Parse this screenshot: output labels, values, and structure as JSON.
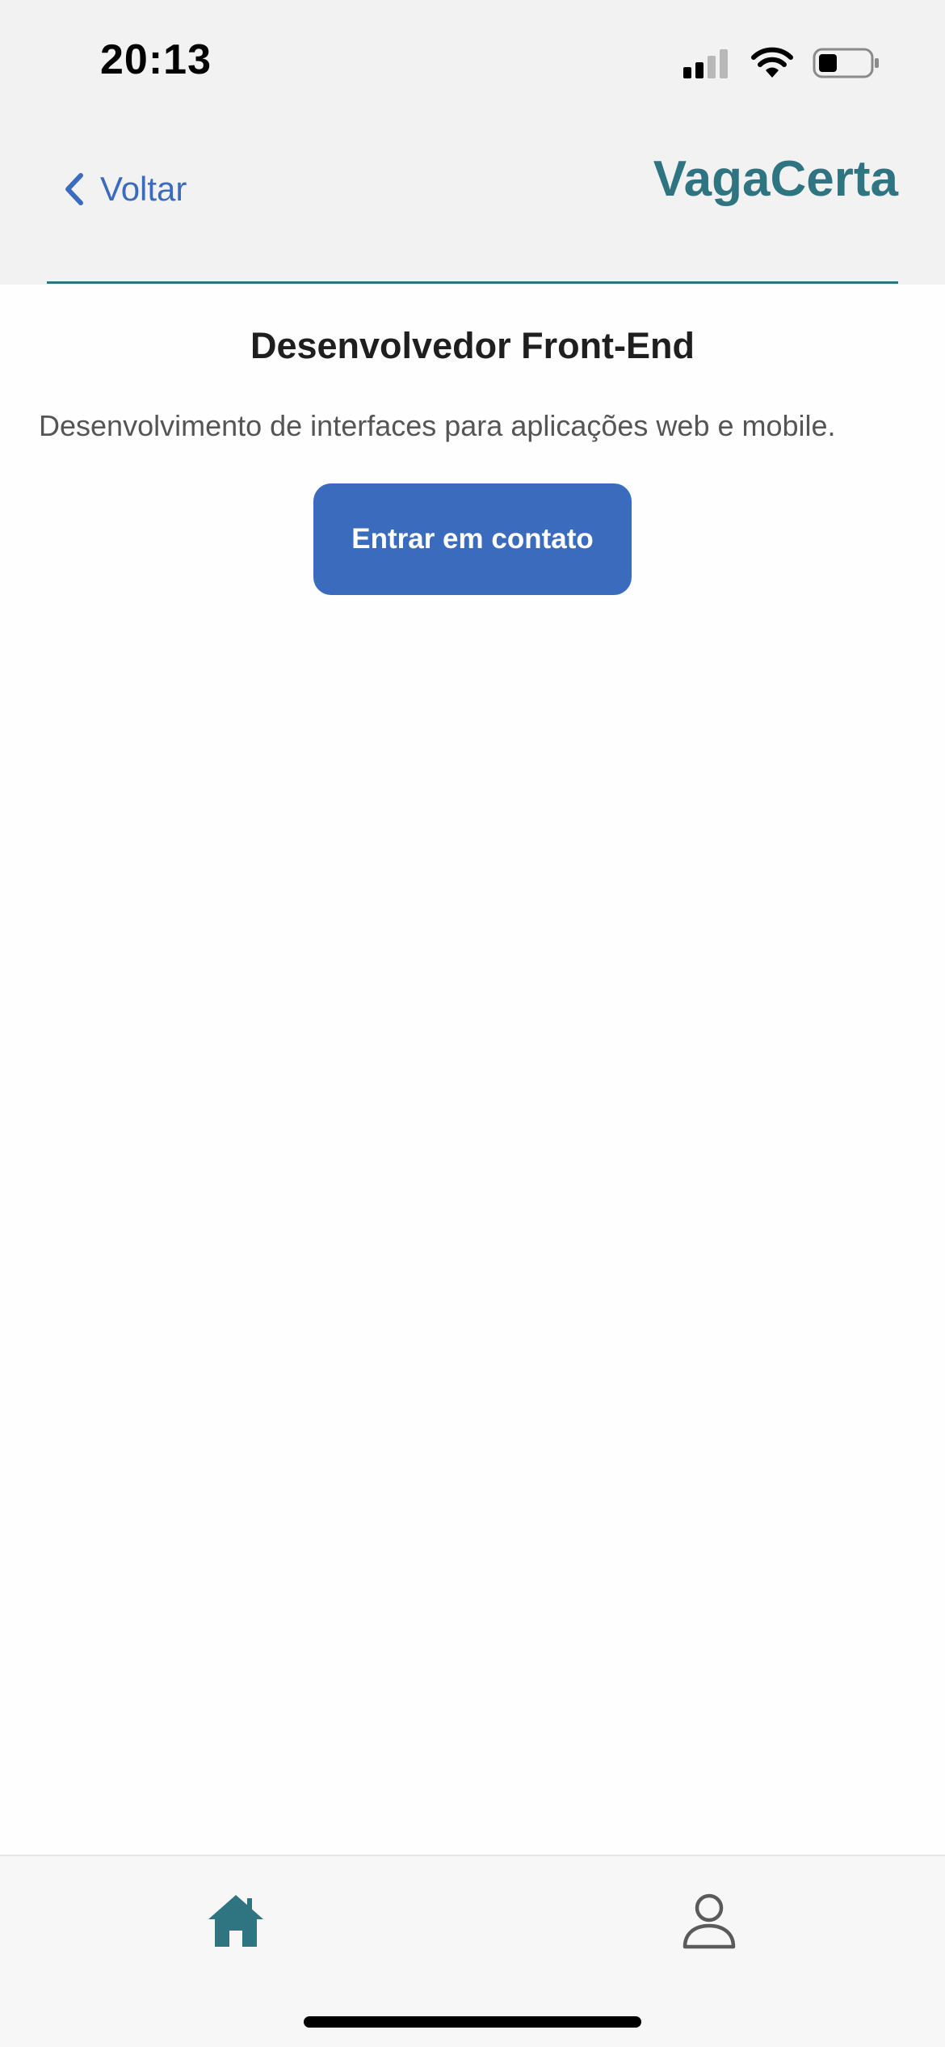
{
  "status_bar": {
    "time": "20:13",
    "icons": [
      "signal-icon",
      "wifi-icon",
      "battery-icon"
    ]
  },
  "header": {
    "back_label": "Voltar",
    "brand": "VagaCerta"
  },
  "job": {
    "title": "Desenvolvedor Front-End",
    "description": "Desenvolvimento de interfaces para aplicações web e mobile.",
    "contact_button_label": "Entrar em contato"
  },
  "tab_bar": {
    "tabs": [
      {
        "icon": "home-icon",
        "active": true
      },
      {
        "icon": "user-icon",
        "active": false
      }
    ]
  },
  "colors": {
    "brand_teal": "#2f7481",
    "accent_blue": "#3a6bbd",
    "header_bg": "#f2f2f2",
    "tab_bar_bg": "#f7f7f7"
  }
}
